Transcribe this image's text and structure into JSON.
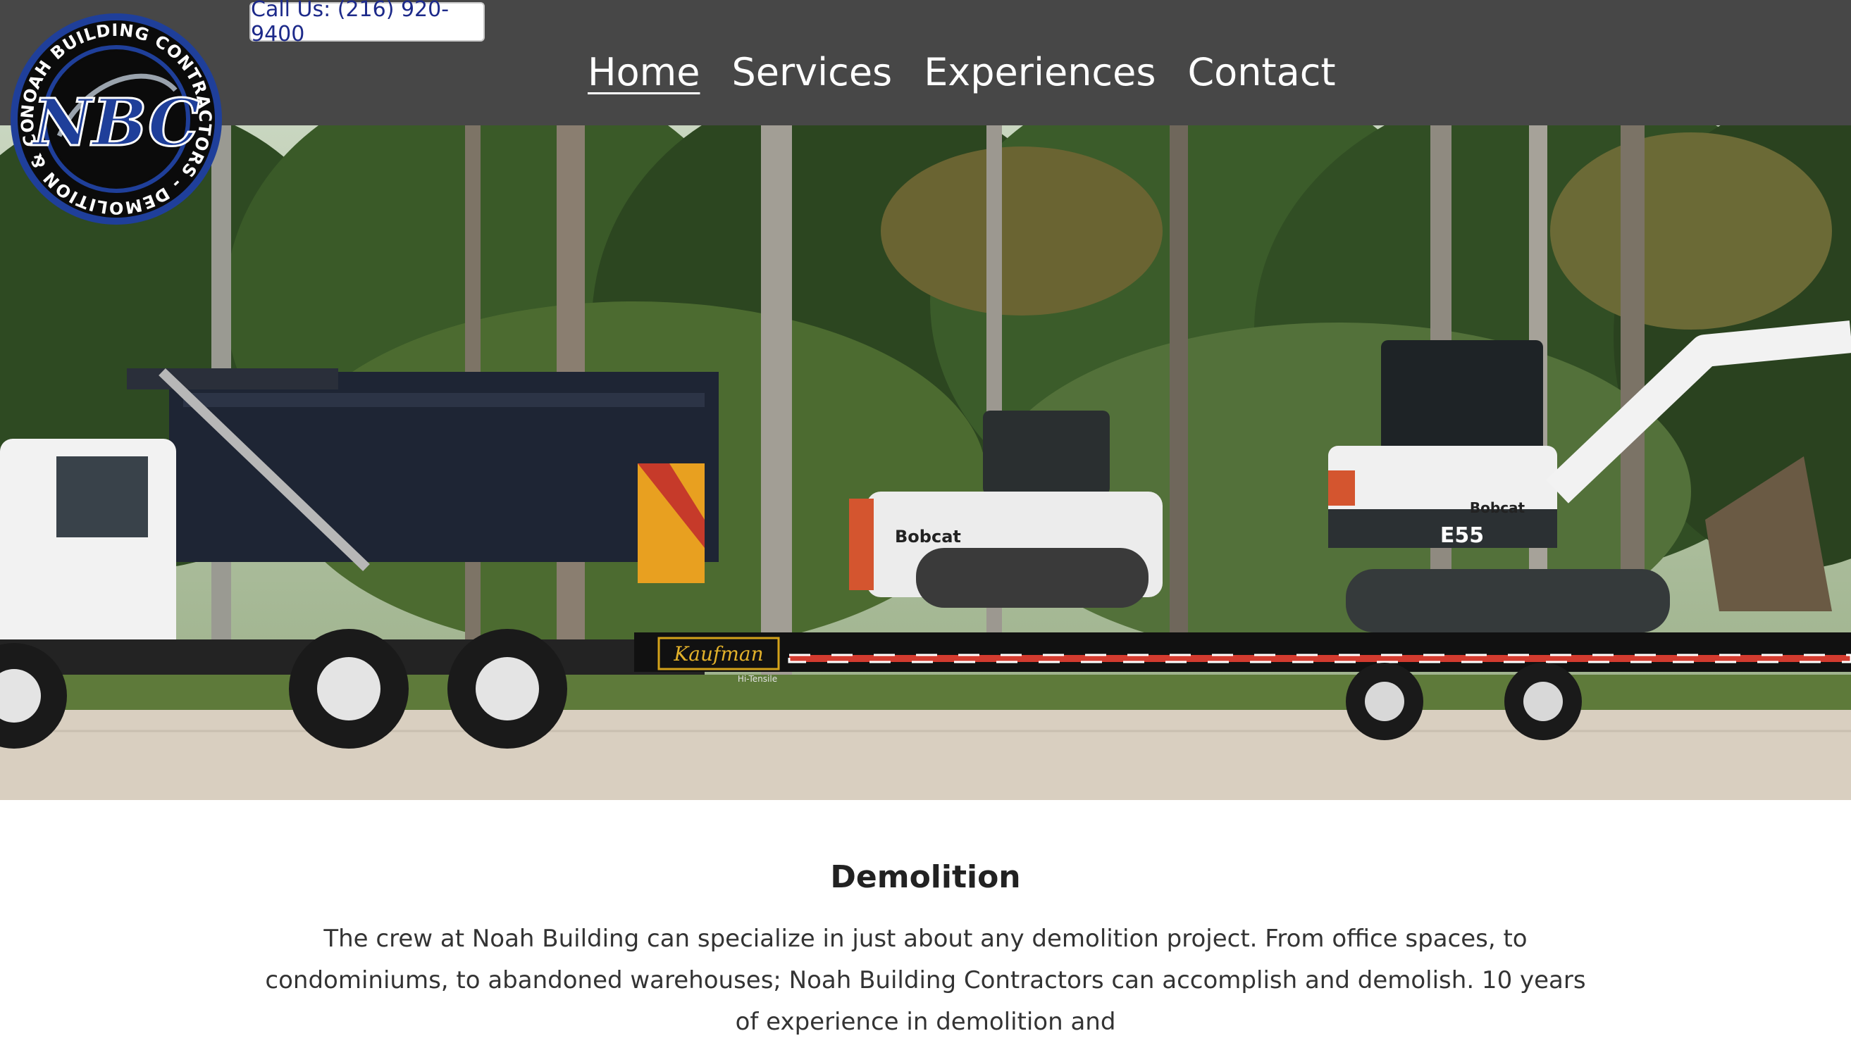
{
  "header": {
    "call_label": "Call Us: (216) 920-9400",
    "nav": [
      {
        "label": "Home",
        "active": true
      },
      {
        "label": "Services",
        "active": false
      },
      {
        "label": "Experiences",
        "active": false
      },
      {
        "label": "Contact",
        "active": false
      }
    ],
    "logo": {
      "ring_text": "NOAH BUILDING CONTRACTORS - DEMOLITION & CONCRETE -",
      "monogram": "NBC"
    }
  },
  "hero": {
    "truck_decal": "Kaufman",
    "trailer_subtext": "Hi-Tensile",
    "machine_brand": "Bobcat",
    "excavator_model": "E55"
  },
  "content": {
    "heading": "Demolition",
    "body": "The crew at Noah Building can specialize in just about any demolition project. From office spaces, to condominiums, to abandoned warehouses; Noah Building Contractors can accomplish and demolish. 10 years of experience in demolition and"
  },
  "colors": {
    "header_bg": "#474747",
    "call_text": "#1d2a8a",
    "logo_blue": "#1f3f9a",
    "logo_black": "#0b0b0b"
  }
}
